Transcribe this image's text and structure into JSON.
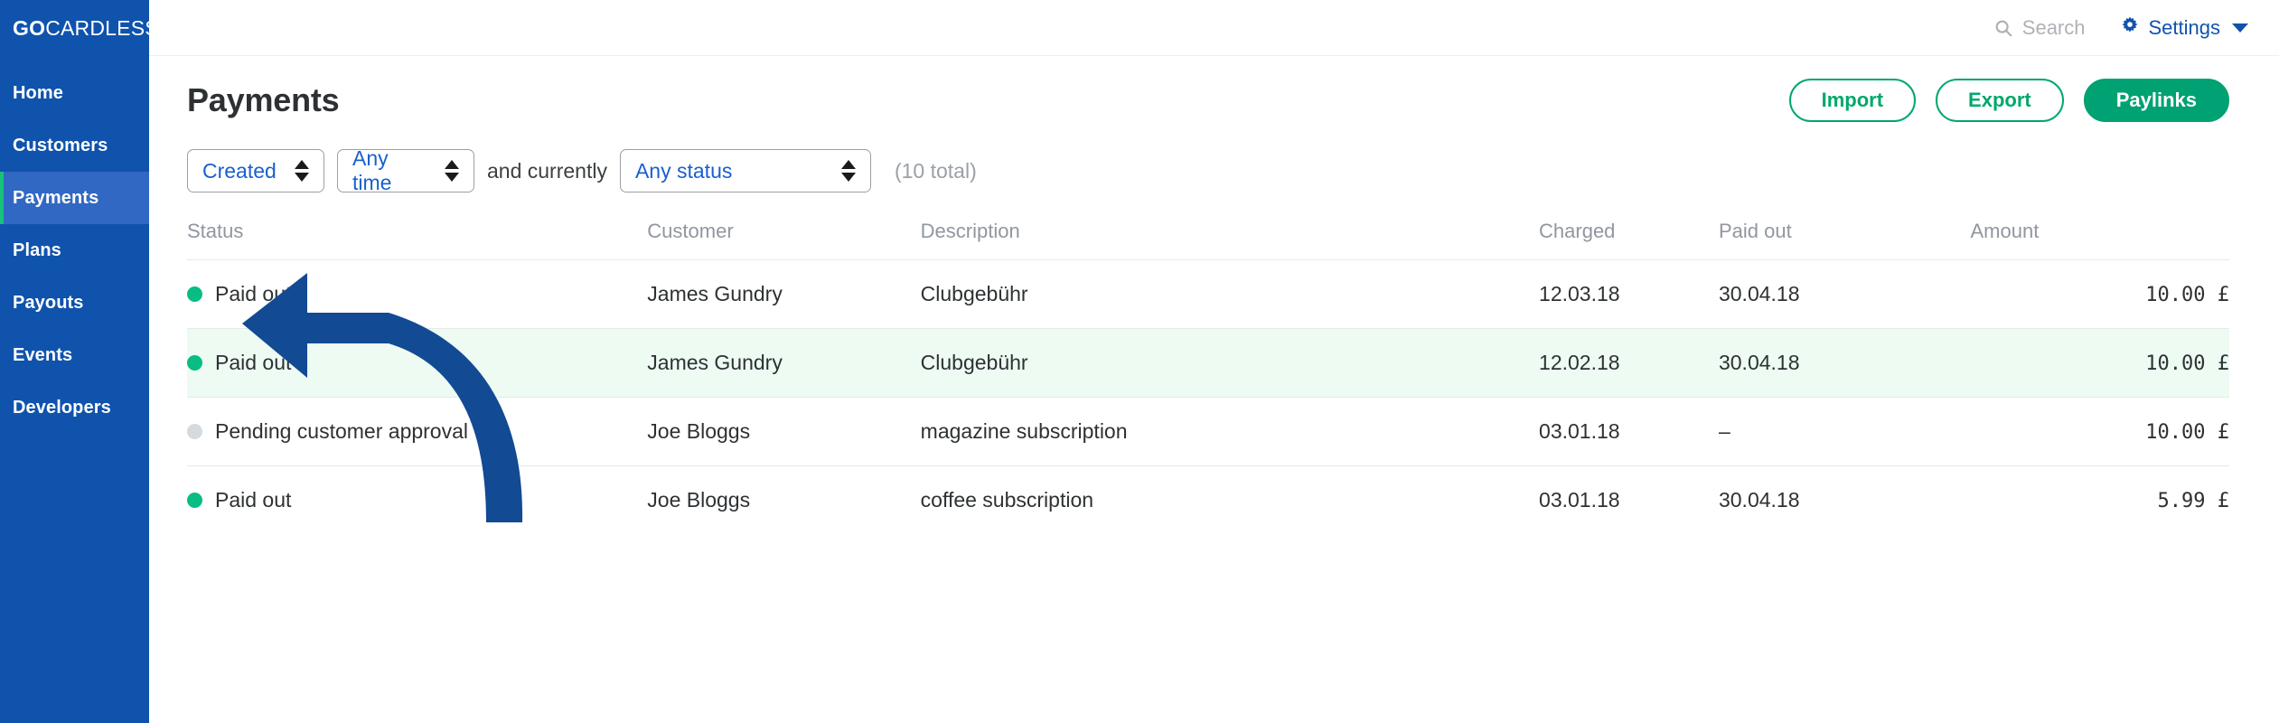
{
  "brand": {
    "strong": "GO",
    "light": "CARDLESS"
  },
  "sidebar": {
    "items": [
      {
        "label": "Home",
        "active": false
      },
      {
        "label": "Customers",
        "active": false
      },
      {
        "label": "Payments",
        "active": true
      },
      {
        "label": "Plans",
        "active": false
      },
      {
        "label": "Payouts",
        "active": false
      },
      {
        "label": "Events",
        "active": false
      },
      {
        "label": "Developers",
        "active": false
      }
    ],
    "active_accent_color": "#18c07d",
    "background_color": "#1053ad"
  },
  "topbar": {
    "search_label": "Search",
    "search_icon": "search-icon",
    "settings_label": "Settings",
    "settings_icon": "gear-icon",
    "caret_icon": "chevron-down-icon"
  },
  "page": {
    "title": "Payments",
    "actions": [
      {
        "label": "Import",
        "style": "outline"
      },
      {
        "label": "Export",
        "style": "outline"
      },
      {
        "label": "Paylinks",
        "style": "primary"
      }
    ],
    "primary_color": "#00a172"
  },
  "filters": {
    "field_select": {
      "value": "Created"
    },
    "time_select": {
      "value": "Any time"
    },
    "conjunction": "and currently",
    "status_select": {
      "value": "Any status"
    },
    "total": "(10 total)"
  },
  "table": {
    "columns": [
      "Status",
      "Customer",
      "Description",
      "Charged",
      "Paid out",
      "Amount"
    ],
    "rows": [
      {
        "status": "Paid out",
        "status_dot": "green",
        "customer": "James Gundry",
        "description": "Clubgebühr",
        "charged": "12.03.18",
        "paid_out": "30.04.18",
        "amount": "10.00 £",
        "highlight": false
      },
      {
        "status": "Paid out",
        "status_dot": "green",
        "customer": "James Gundry",
        "description": "Clubgebühr",
        "charged": "12.02.18",
        "paid_out": "30.04.18",
        "amount": "10.00 £",
        "highlight": true
      },
      {
        "status": "Pending customer approval",
        "status_dot": "grey",
        "customer": "Joe Bloggs",
        "description": "magazine subscription",
        "charged": "03.01.18",
        "paid_out": "–",
        "amount": "10.00 £",
        "highlight": false
      },
      {
        "status": "Paid out",
        "status_dot": "green",
        "customer": "Joe Bloggs",
        "description": "coffee subscription",
        "charged": "03.01.18",
        "paid_out": "30.04.18",
        "amount": " 5.99 £",
        "highlight": false
      }
    ]
  },
  "annotation": {
    "arrow_color": "#124a93",
    "arrow_description": "curved-left-arrow"
  }
}
